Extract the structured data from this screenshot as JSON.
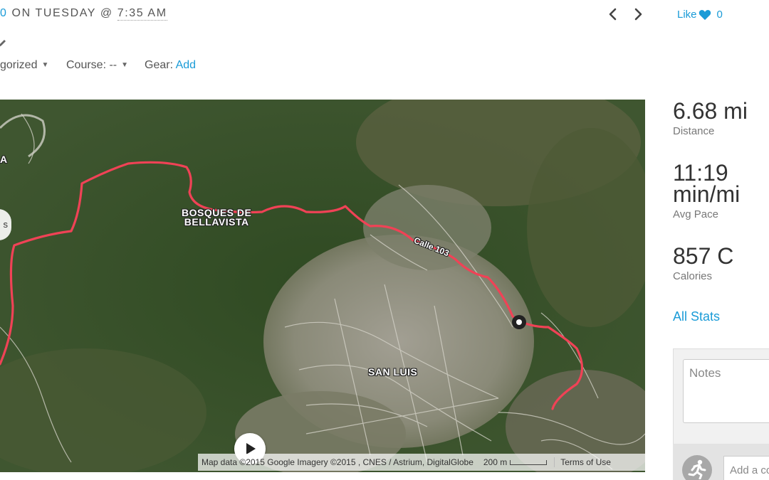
{
  "header": {
    "prefix_fragment": "0",
    "day_text": " ON TUESDAY @ ",
    "time": "7:35 AM",
    "like_label": "Like",
    "like_count": "0"
  },
  "meta": {
    "category_label": "gorized",
    "course_label": "Course: --",
    "gear_label": "Gear:",
    "gear_add": "Add"
  },
  "map": {
    "labels": {
      "left_fragment_1": "s",
      "left_fragment_2": "A",
      "bosques_line1": "BOSQUES DE",
      "bosques_line2": "BELLAVISTA",
      "street": "Calle 103",
      "san_luis": "SAN LUIS"
    },
    "attribution": "Map data ©2015 Google Imagery ©2015 , CNES / Astrium, DigitalGlobe",
    "scale_label": "200 m",
    "terms": "Terms of Use",
    "route_color": "#e8243a"
  },
  "stats": {
    "distance_value": "6.68 mi",
    "distance_label": "Distance",
    "pace_value_line1": "11:19",
    "pace_value_line2": "min/mi",
    "pace_label": "Avg Pace",
    "calories_value": "857 C",
    "calories_label": "Calories",
    "all_stats_link": "All Stats"
  },
  "notes": {
    "placeholder": "Notes",
    "comment_placeholder": "Add a co"
  },
  "colors": {
    "accent": "#1a9bd7",
    "text": "#555555",
    "route": "#e8243a"
  }
}
